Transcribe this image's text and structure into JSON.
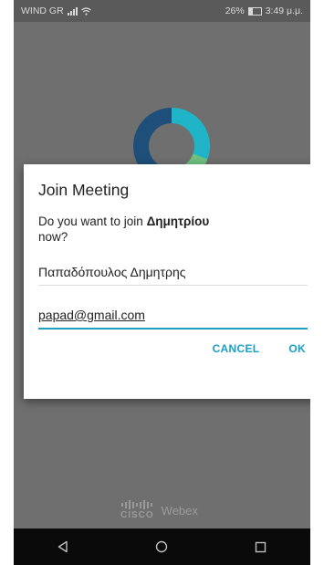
{
  "statusbar": {
    "carrier": "WIND GR",
    "battery": "26%",
    "time": "3:49 μ.μ."
  },
  "dialog": {
    "title": "Join Meeting",
    "message_prefix": "Do you want to join ",
    "host_name": "Δημητρίου",
    "message_suffix": "now?",
    "name_value": "Παπαδόπουλος Δημητρης",
    "email_value": "papad@gmail.com",
    "cancel_label": "CANCEL",
    "ok_label": "OK"
  },
  "branding": {
    "company": "CISCO",
    "product": "Webex"
  },
  "navbar": {
    "back": "back-icon",
    "home": "home-icon",
    "recents": "recents-icon"
  },
  "colors": {
    "accent": "#1aa0c4",
    "backdrop": "#6f6f6f",
    "navbar": "#0a0a0a"
  }
}
